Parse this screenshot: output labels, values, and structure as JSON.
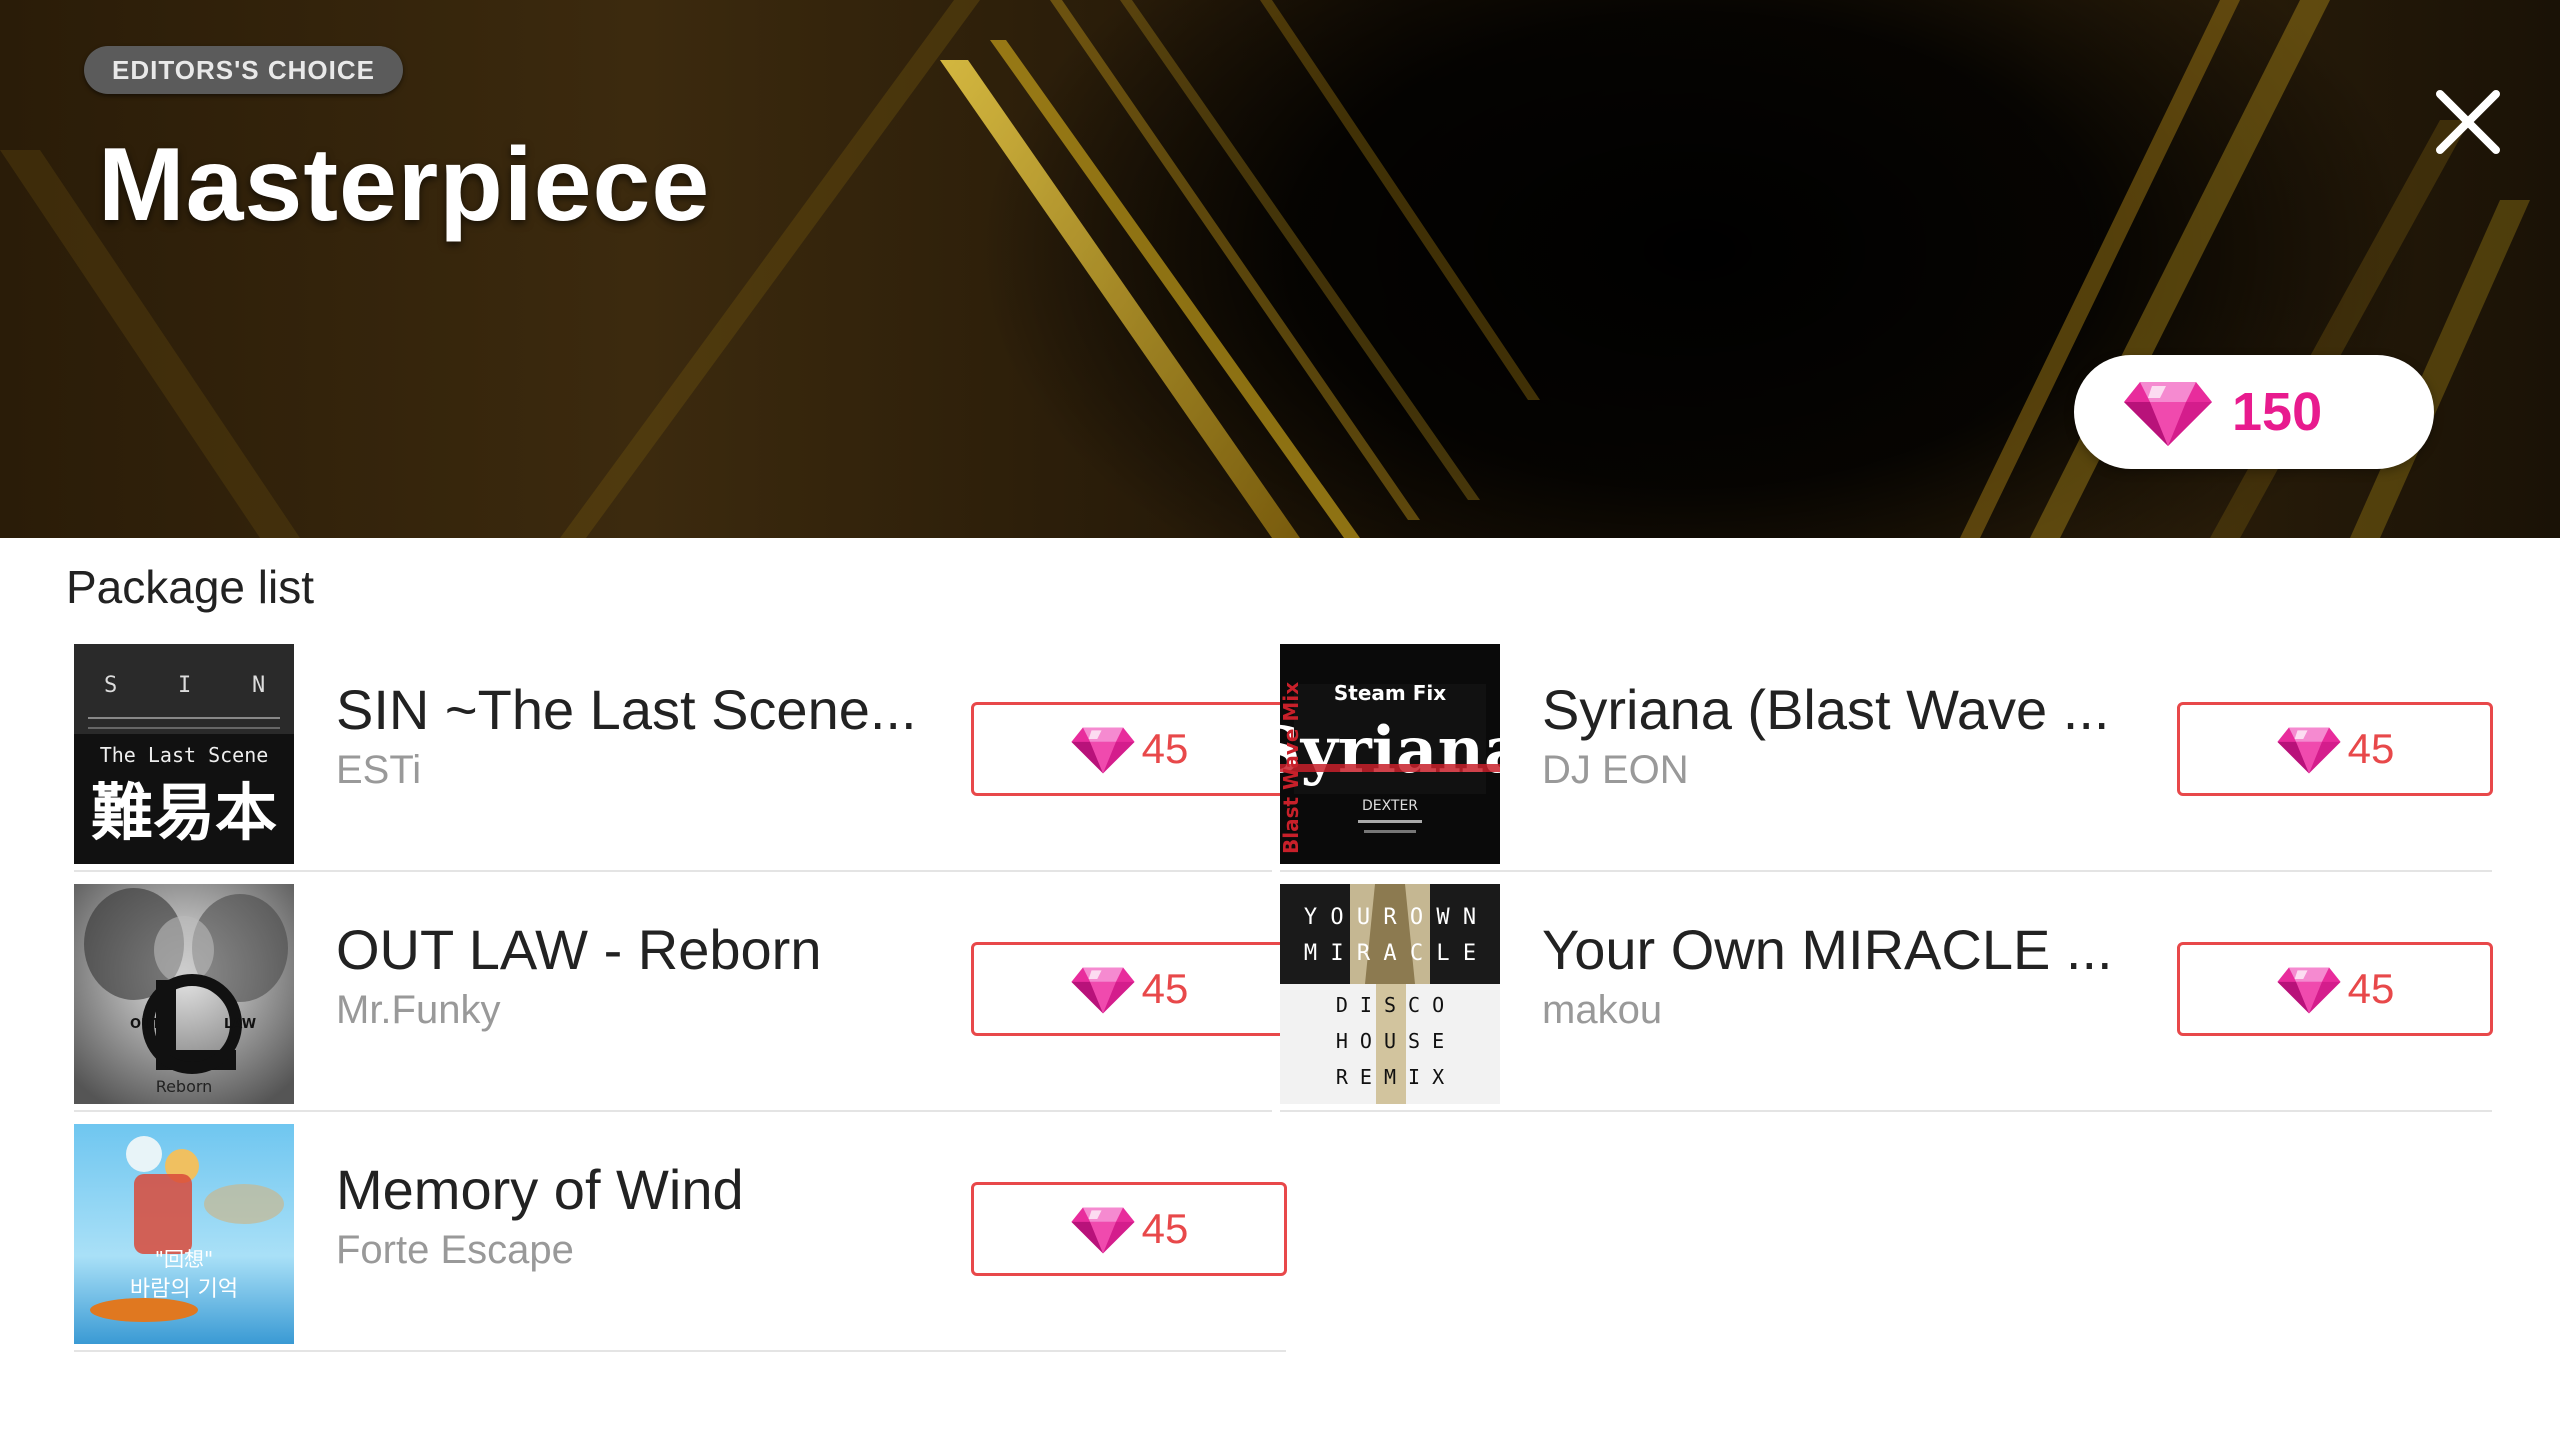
{
  "header": {
    "badge": "EDITORS'S CHOICE",
    "title": "Masterpiece",
    "price": "150",
    "close_icon": "close-icon",
    "gem_icon": "gem-icon"
  },
  "section_title": "Package list",
  "packages": [
    {
      "title": "SIN ~The Last Scene...",
      "artist": "ESTi",
      "price": "45",
      "cover_text": [
        "S",
        "I",
        "N",
        "The Last Scene",
        "難易本"
      ]
    },
    {
      "title": "Syriana (Blast Wave ...",
      "artist": "DJ EON",
      "price": "45",
      "cover_text": [
        "Steam Fix",
        "Syriana",
        "Blast Wave Mix",
        "DEXTER"
      ]
    },
    {
      "title": "OUT LAW - Reborn",
      "artist": "Mr.Funky",
      "price": "45",
      "cover_text": [
        "OUT",
        "LAW",
        "Reborn"
      ]
    },
    {
      "title": "Your Own MIRACLE ...",
      "artist": "makou",
      "price": "45",
      "cover_text": [
        "Y O U R  O W N",
        "M I R A C L E",
        "D I S C O",
        "H O U S E",
        "R E M I X"
      ]
    },
    {
      "title": "Memory of Wind",
      "artist": "Forte Escape",
      "price": "45",
      "cover_text": [
        "\"回想\"",
        "바람의 기억"
      ]
    }
  ],
  "colors": {
    "accent_pink": "#e81b8e",
    "button_red": "#e8484a",
    "gold_stripe": "#d4a017"
  }
}
